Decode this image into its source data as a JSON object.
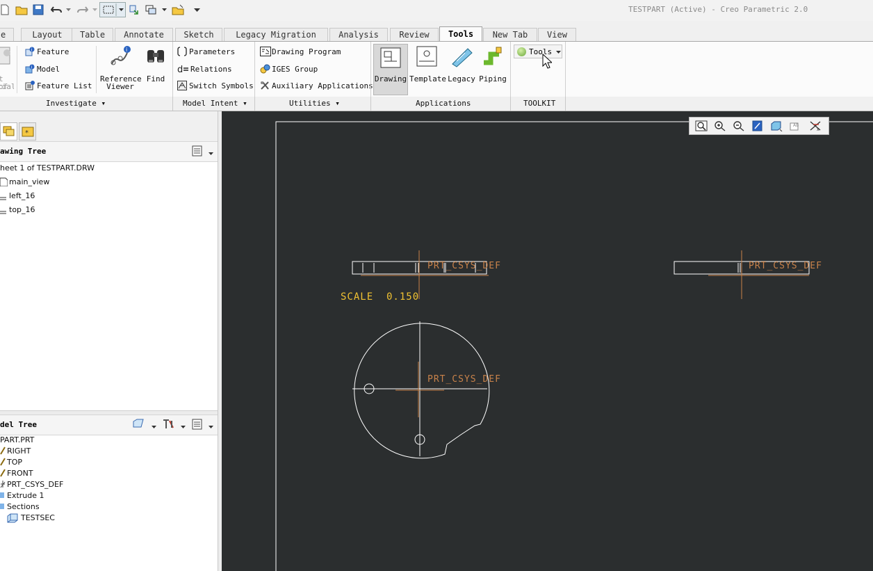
{
  "window": {
    "title": "TESTPART (Active) - Creo Parametric 2.0"
  },
  "tabs": [
    {
      "label": "e"
    },
    {
      "label": "Layout"
    },
    {
      "label": "Table"
    },
    {
      "label": "Annotate"
    },
    {
      "label": "Sketch"
    },
    {
      "label": "Legacy Migration"
    },
    {
      "label": "Analysis"
    },
    {
      "label": "Review"
    },
    {
      "label": "Tools"
    },
    {
      "label": "New Tab"
    },
    {
      "label": "View"
    }
  ],
  "active_tab": "Tools",
  "ribbon": {
    "partial_left": {
      "line1": "t of",
      "line2": "rials"
    },
    "investigate": {
      "feature": "Feature",
      "model": "Model",
      "feature_list": "Feature List",
      "reference_viewer_1": "Reference",
      "reference_viewer_2": "Viewer",
      "find": "Find"
    },
    "model_intent": {
      "parameters": "Parameters",
      "relations": "Relations",
      "switch_symbols": "Switch Symbols"
    },
    "utilities": {
      "drawing_program": "Drawing Program",
      "iges_group": "IGES Group",
      "auxiliary_applications": "Auxiliary Applications"
    },
    "applications": {
      "drawing": "Drawing",
      "template": "Template",
      "legacy": "Legacy",
      "piping": "Piping"
    },
    "toolkit": {
      "tools": "Tools"
    }
  },
  "groups": {
    "investigate": "Investigate",
    "model_intent": "Model Intent",
    "utilities": "Utilities",
    "applications": "Applications",
    "toolkit": "TOOLKIT"
  },
  "drawing_tree": {
    "header": "awing Tree",
    "items": [
      "heet 1 of TESTPART.DRW",
      "main_view",
      "left_16",
      "top_16"
    ]
  },
  "model_tree": {
    "header": "del Tree",
    "items": [
      "PART.PRT",
      "RIGHT",
      "TOP",
      "FRONT",
      "PRT_CSYS_DEF",
      "Extrude 1",
      "Sections",
      "TESTSEC"
    ]
  },
  "drawing": {
    "scale_label": "SCALE  0.150",
    "csys_labels": [
      "PRT_CSYS_DEF",
      "PRT_CSYS_DEF",
      "PRT_CSYS_DEF"
    ]
  },
  "colors": {
    "canvas": "#2b2e2f",
    "geometry": "#ffffff",
    "axis": "#c8824a",
    "annotation": "#f1c232"
  }
}
